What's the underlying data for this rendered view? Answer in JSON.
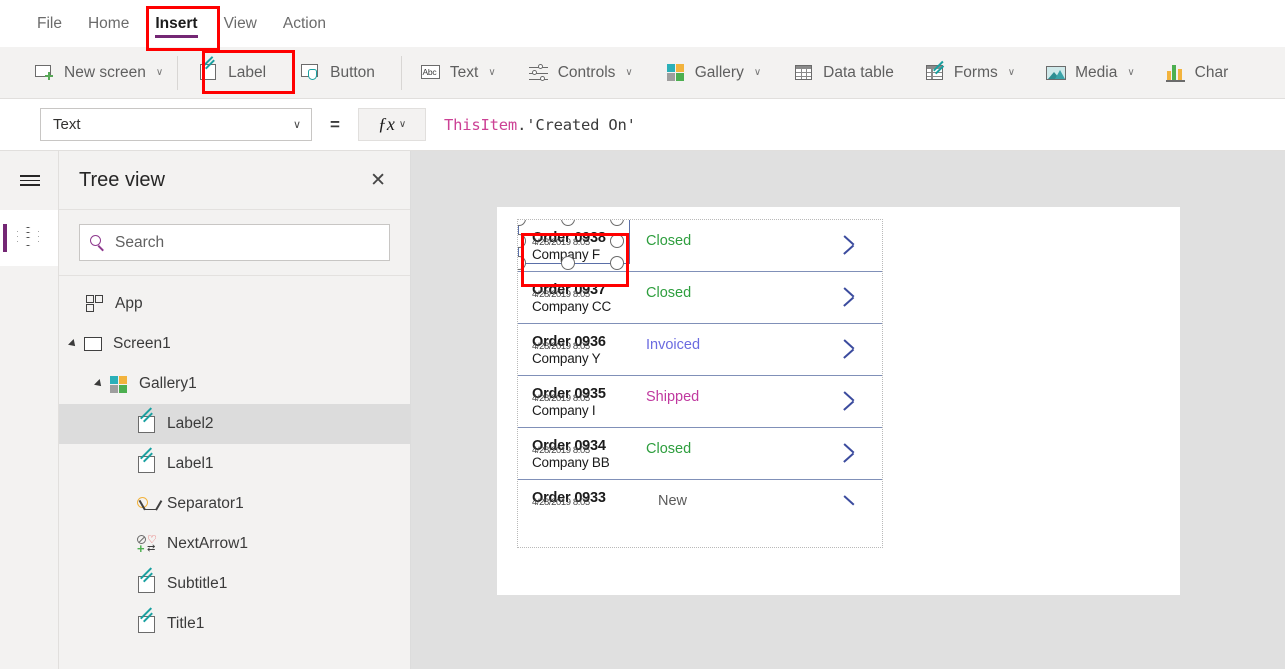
{
  "menu": {
    "items": [
      {
        "label": "File",
        "active": false
      },
      {
        "label": "Home",
        "active": false
      },
      {
        "label": "Insert",
        "active": true
      },
      {
        "label": "View",
        "active": false
      },
      {
        "label": "Action",
        "active": false
      }
    ]
  },
  "ribbon": {
    "items": [
      {
        "label": "New screen",
        "icon": "new-screen-icon",
        "chevron": "∨"
      },
      {
        "label": "Label",
        "icon": "label-icon",
        "chevron": ""
      },
      {
        "label": "Button",
        "icon": "button-icon",
        "chevron": ""
      },
      {
        "label": "Text",
        "icon": "text-abc-icon",
        "chevron": "∨",
        "icon_text": "Abc"
      },
      {
        "label": "Controls",
        "icon": "controls-sliders-icon",
        "chevron": "∨"
      },
      {
        "label": "Gallery",
        "icon": "gallery-icon",
        "chevron": "∨"
      },
      {
        "label": "Data table",
        "icon": "data-table-icon",
        "chevron": ""
      },
      {
        "label": "Forms",
        "icon": "forms-icon",
        "chevron": "∨"
      },
      {
        "label": "Media",
        "icon": "media-image-icon",
        "chevron": "∨"
      },
      {
        "label": "Char",
        "icon": "charts-icon",
        "chevron": ""
      }
    ]
  },
  "formula_bar": {
    "property": "Text",
    "property_chevron": "∨",
    "equals": "=",
    "fx_label": "ƒx",
    "fx_chevron": "∨",
    "formula_keyword": "ThisItem",
    "formula_rest": ".'Created On'"
  },
  "tree_view": {
    "title": "Tree view",
    "close": "✕",
    "search_placeholder": "Search",
    "items": [
      {
        "label": "App",
        "icon": "app-icon",
        "indent": 0,
        "caret": false,
        "selected": false
      },
      {
        "label": "Screen1",
        "icon": "screen-icon",
        "indent": 0,
        "caret": true,
        "selected": false
      },
      {
        "label": "Gallery1",
        "icon": "gallery-icon",
        "indent": 1,
        "caret": true,
        "selected": false
      },
      {
        "label": "Label2",
        "icon": "label-icon",
        "indent": 2,
        "caret": false,
        "selected": true
      },
      {
        "label": "Label1",
        "icon": "label-icon",
        "indent": 2,
        "caret": false,
        "selected": false
      },
      {
        "label": "Separator1",
        "icon": "separator-icon",
        "indent": 2,
        "caret": false,
        "selected": false
      },
      {
        "label": "NextArrow1",
        "icon": "next-arrow-icon",
        "indent": 2,
        "caret": false,
        "selected": false
      },
      {
        "label": "Subtitle1",
        "icon": "label-icon",
        "indent": 2,
        "caret": false,
        "selected": false
      },
      {
        "label": "Title1",
        "icon": "label-icon",
        "indent": 2,
        "caret": false,
        "selected": false
      }
    ]
  },
  "canvas": {
    "gallery_rows": [
      {
        "title": "Order 0938",
        "subtitle": "Company F",
        "date": "4/28/2019 8:05",
        "status": "Closed",
        "status_kind": "closed",
        "selected": true
      },
      {
        "title": "Order 0937",
        "subtitle": "Company CC",
        "date": "4/28/2019 8:05",
        "status": "Closed",
        "status_kind": "closed",
        "selected": false
      },
      {
        "title": "Order 0936",
        "subtitle": "Company Y",
        "date": "4/28/2019 8:05",
        "status": "Invoiced",
        "status_kind": "invoiced",
        "selected": false
      },
      {
        "title": "Order 0935",
        "subtitle": "Company I",
        "date": "4/28/2019 8:05",
        "status": "Shipped",
        "status_kind": "shipped",
        "selected": false
      },
      {
        "title": "Order 0934",
        "subtitle": "Company BB",
        "date": "4/28/2019 8:05",
        "status": "Closed",
        "status_kind": "closed",
        "selected": false
      },
      {
        "title": "Order 0933",
        "subtitle": "",
        "date": "4/28/2019 8:05",
        "status": "New",
        "status_kind": "new",
        "selected": false
      }
    ]
  },
  "colors": {
    "accent_purple": "#742774",
    "annotation_red": "#ff0000",
    "status_closed": "#2e9e3e",
    "status_invoiced": "#6b6be0",
    "status_shipped": "#c0399f",
    "status_new": "#5a5a5a",
    "formula_keyword": "#cc4195",
    "chevron_navy": "#3b4b9e"
  }
}
